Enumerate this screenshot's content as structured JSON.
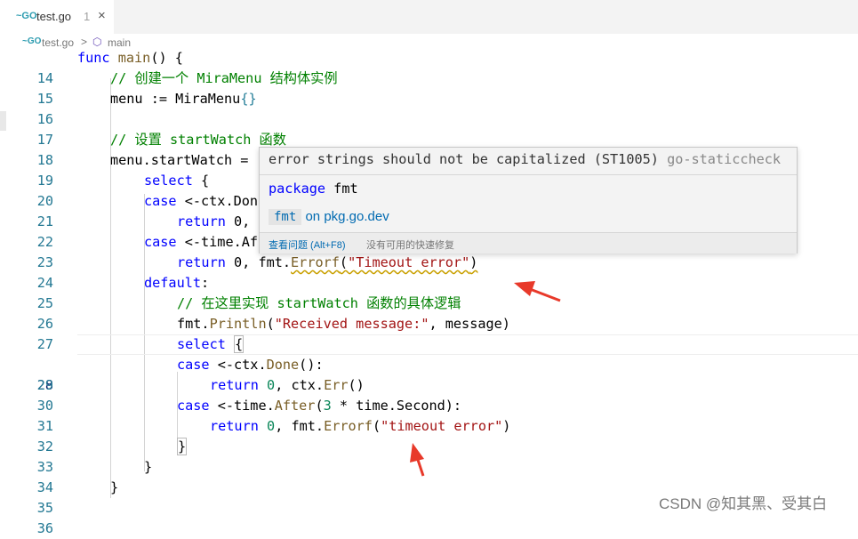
{
  "tab": {
    "filename": "test.go",
    "badge": "1",
    "close": "×",
    "icon": "~GO"
  },
  "breadcrumb": {
    "file": "test.go",
    "separator": ">",
    "symbol_icon": "⬡",
    "function": "main",
    "icon": "~GO"
  },
  "lines": [
    {
      "n": "14"
    },
    {
      "n": "15"
    },
    {
      "n": "16"
    },
    {
      "n": "17"
    },
    {
      "n": "18"
    },
    {
      "n": "19"
    },
    {
      "n": "20"
    },
    {
      "n": "21"
    },
    {
      "n": "22"
    },
    {
      "n": "23"
    },
    {
      "n": "24"
    },
    {
      "n": "25"
    },
    {
      "n": "26"
    },
    {
      "n": "27"
    },
    {
      "n": "28"
    },
    {
      "n": "29"
    },
    {
      "n": "30"
    },
    {
      "n": "31"
    },
    {
      "n": "32"
    },
    {
      "n": "33"
    },
    {
      "n": "34"
    },
    {
      "n": "35"
    },
    {
      "n": "36"
    }
  ],
  "code": {
    "l14": [
      "func",
      " ",
      "main",
      "() {"
    ],
    "l15": "// 创建一个 MiraMenu 结构体实例",
    "l16": [
      "menu := MiraMenu",
      "{}"
    ],
    "l18": "// 设置 startWatch 函数",
    "l19": "menu.startWatch = ",
    "l20": [
      "select",
      " {"
    ],
    "l21": [
      "case",
      " <-ctx.Don"
    ],
    "l22": [
      "return",
      " 0,"
    ],
    "l23": [
      "case",
      " <-time.Af"
    ],
    "l24": [
      "return",
      " 0, fmt.",
      "Errorf",
      "(",
      "\"Timeout error\"",
      ")"
    ],
    "l25": [
      "default",
      ":"
    ],
    "l26": "// 在这里实现 startWatch 函数的具体逻辑",
    "l27": [
      "fmt.",
      "Println",
      "(",
      "\"Received message:\"",
      ", message)"
    ],
    "l28": [
      "select",
      " ",
      "{"
    ],
    "l29": [
      "case",
      " <-ctx.",
      "Done",
      "():"
    ],
    "l30": [
      "return",
      " ",
      "0",
      ", ctx.",
      "Err",
      "()"
    ],
    "l31": [
      "case",
      " <-time.",
      "After",
      "(",
      "3",
      " * time.Second):"
    ],
    "l32": [
      "return",
      " ",
      "0",
      ", fmt.",
      "Errorf",
      "(",
      "\"timeout error\"",
      ")"
    ],
    "l33": "}",
    "l34": "}",
    "l35": "}"
  },
  "hover": {
    "message": "error strings should not be capitalized (ST1005)",
    "source": "go-staticcheck",
    "pkg_keyword": "package",
    "pkg_name": "fmt",
    "link_code": "fmt",
    "link_text": " on pkg.go.dev",
    "view_problem": "查看问题 (Alt+F8)",
    "no_fix": "没有可用的快速修复"
  },
  "watermark": "CSDN @知其黑、受其白",
  "colors": {
    "arrow": "#e8392a",
    "keyword": "#0000ff",
    "comment": "#008000",
    "string": "#a31515",
    "function": "#795e26"
  }
}
